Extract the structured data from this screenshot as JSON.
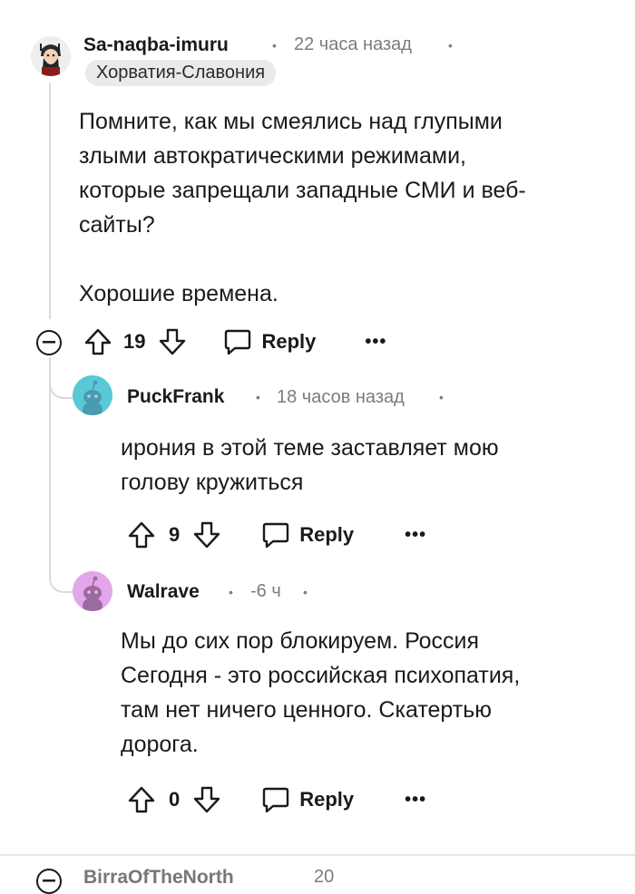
{
  "comments": [
    {
      "username": "Sa-naqba-imuru",
      "time": "22 часа назад",
      "flair": "Хорватия-Славония",
      "body": [
        "Помните, как мы смеялись над глупыми",
        "злыми автократическими режимами,",
        "которые запрещали западные СМИ и веб-",
        "сайты?",
        "",
        "Хорошие времена."
      ],
      "votes": "19",
      "reply_label": "Reply",
      "avatar_color": "#f2f2f2"
    },
    {
      "username": "PuckFrank",
      "time": "18 часов назад",
      "body": [
        "ирония в этой теме заставляет мою",
        "голову кружиться"
      ],
      "votes": "9",
      "reply_label": "Reply",
      "avatar_color": "#5bc8d8"
    },
    {
      "username": "Walrave",
      "time": "-6 ч",
      "body": [
        "Мы до сих пор блокируем. Россия",
        "Сегодня - это российская психопатия,",
        "там нет ничего ценного. Скатертью",
        "дорога."
      ],
      "votes": "0",
      "reply_label": "Reply",
      "avatar_color": "#e4a6ea"
    }
  ],
  "next_comment": {
    "username_fragment": "BirraOfTheNorth",
    "time_fragment": "20"
  },
  "more_label": "•••",
  "meta_dot": "•",
  "icons": [
    "collapse-icon",
    "upvote-icon",
    "downvote-icon",
    "reply-icon",
    "more-icon"
  ]
}
